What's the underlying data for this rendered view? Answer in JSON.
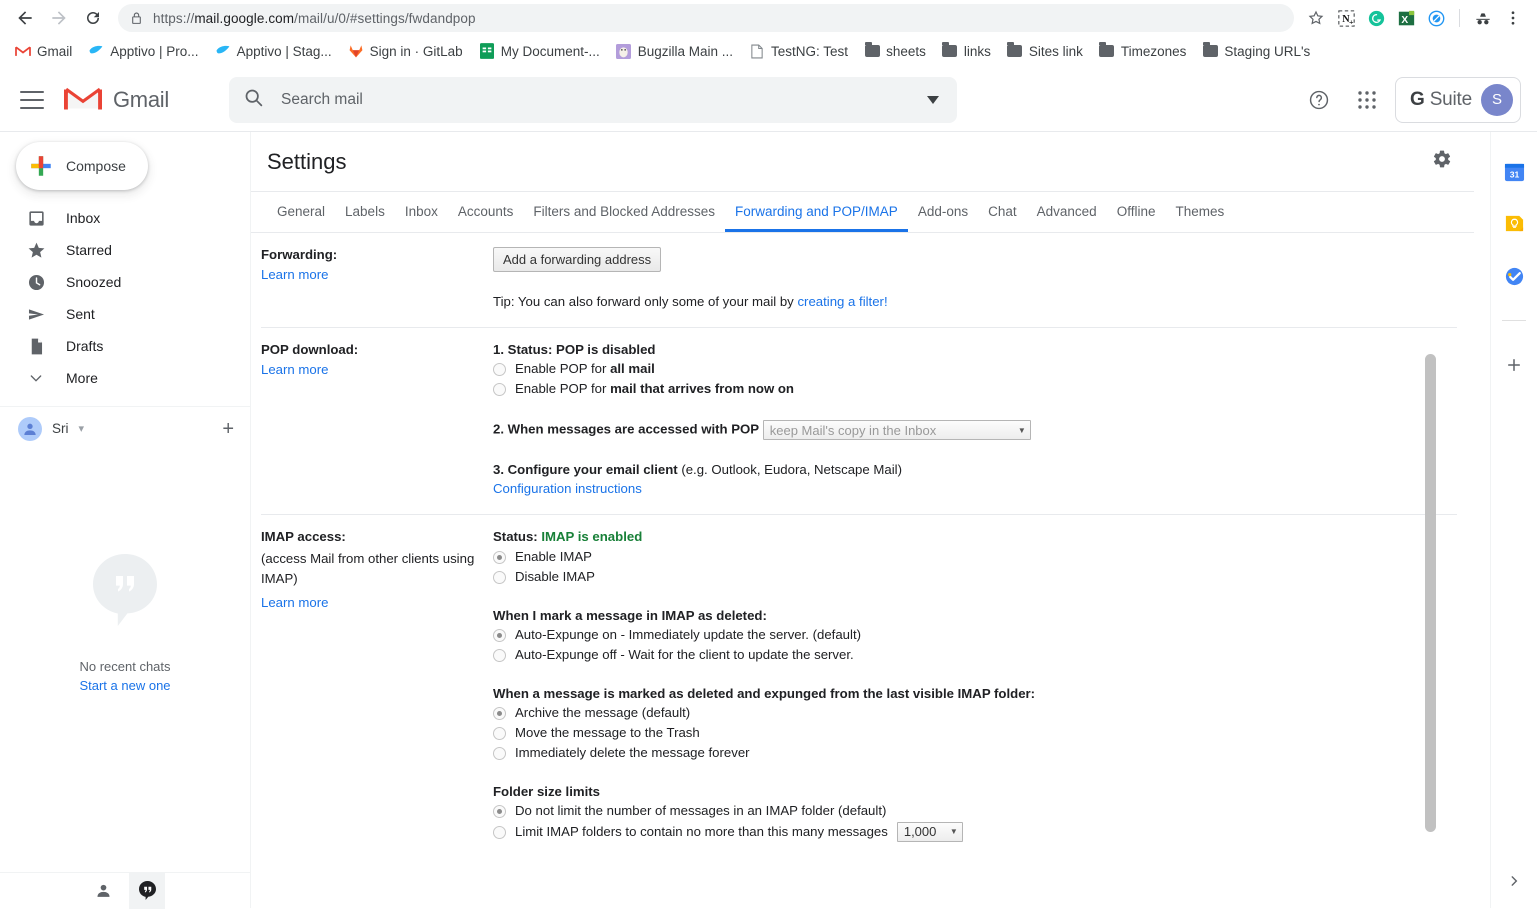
{
  "browser": {
    "url_prefix": "https://",
    "url_host": "mail.google.com",
    "url_path": "/mail/u/0/#settings/fwdandpop",
    "back_icon": "←",
    "forward_icon": "→",
    "reload_icon": "⟳",
    "lock_icon": "lock-icon",
    "star_icon": "star-icon",
    "extension_icons": [
      "notion-extension-icon",
      "grammarly-extension-icon",
      "excel-extension-icon",
      "colorzilla-extension-icon"
    ],
    "incognito_icon": "incognito-icon",
    "menu_icon": "kebab-menu-icon",
    "bookmarks": [
      {
        "label": "Gmail",
        "icon": "gmail-icon"
      },
      {
        "label": "Apptivo | Pro...",
        "icon": "apptivo-icon"
      },
      {
        "label": "Apptivo | Stag...",
        "icon": "apptivo-icon"
      },
      {
        "label": "Sign in · GitLab",
        "icon": "gitlab-icon"
      },
      {
        "label": "My Document-...",
        "icon": "sheets-icon"
      },
      {
        "label": "Bugzilla Main ...",
        "icon": "bugzilla-icon"
      },
      {
        "label": "TestNG: Test",
        "icon": "page-icon"
      },
      {
        "label": "sheets",
        "icon": "folder-icon"
      },
      {
        "label": "links",
        "icon": "folder-icon"
      },
      {
        "label": "Sites link",
        "icon": "folder-icon"
      },
      {
        "label": "Timezones",
        "icon": "folder-icon"
      },
      {
        "label": "Staging URL's",
        "icon": "folder-icon"
      }
    ]
  },
  "gmail_header": {
    "menu_icon": "hamburger-menu-icon",
    "logo_label": "Gmail",
    "search_placeholder": "Search mail",
    "search_value": "",
    "search_icon": "search-icon",
    "search_options_icon": "chevron-down-icon",
    "help_icon": "help-icon",
    "apps_icon": "google-apps-grid-icon",
    "gsuite_g": "G",
    "gsuite_label": " Suite",
    "avatar_initial": "S"
  },
  "sidebar": {
    "compose_label": "Compose",
    "compose_icon": "plus-icon",
    "items": [
      {
        "label": "Inbox",
        "icon": "inbox-icon"
      },
      {
        "label": "Starred",
        "icon": "star-icon"
      },
      {
        "label": "Snoozed",
        "icon": "clock-icon"
      },
      {
        "label": "Sent",
        "icon": "send-icon"
      },
      {
        "label": "Drafts",
        "icon": "draft-icon"
      },
      {
        "label": "More",
        "icon": "chevron-down-icon"
      }
    ],
    "hangouts_user": "Sri",
    "hangouts_user_caret": "▾",
    "hangouts_add_icon": "plus-icon",
    "chat_empty_icon": "hangouts-bubble-icon",
    "chat_empty_text": "No recent chats",
    "chat_new_link": "Start a new one",
    "footer_contacts_icon": "person-icon",
    "footer_hangouts_icon": "hangouts-icon"
  },
  "settings": {
    "title": "Settings",
    "gear_icon": "gear-icon",
    "tabs": [
      {
        "label": "General",
        "active": false
      },
      {
        "label": "Labels",
        "active": false
      },
      {
        "label": "Inbox",
        "active": false
      },
      {
        "label": "Accounts",
        "active": false
      },
      {
        "label": "Filters and Blocked Addresses",
        "active": false
      },
      {
        "label": "Forwarding and POP/IMAP",
        "active": true
      },
      {
        "label": "Add-ons",
        "active": false
      },
      {
        "label": "Chat",
        "active": false
      },
      {
        "label": "Advanced",
        "active": false
      },
      {
        "label": "Offline",
        "active": false
      },
      {
        "label": "Themes",
        "active": false
      }
    ],
    "forwarding": {
      "label": "Forwarding:",
      "learn_more": "Learn more",
      "add_button": "Add a forwarding address",
      "tip_prefix": "Tip: You can also forward only some of your mail by ",
      "tip_link": "creating a filter!"
    },
    "pop": {
      "label": "POP download:",
      "learn_more": "Learn more",
      "status_line": "1. Status: POP is disabled",
      "opt_all_prefix": "Enable POP for ",
      "opt_all_bold": "all mail",
      "opt_new_prefix": "Enable POP for ",
      "opt_new_bold": "mail that arrives from now on",
      "step2_label": "2. When messages are accessed with POP",
      "step2_select_value": "keep Mail's copy in the Inbox",
      "step3_bold": "3. Configure your email client",
      "step3_rest": " (e.g. Outlook, Eudora, Netscape Mail)",
      "config_link": "Configuration instructions"
    },
    "imap": {
      "label": "IMAP access:",
      "sub": "(access Mail from other clients using IMAP)",
      "learn_more": "Learn more",
      "status_prefix": "Status: ",
      "status_value": "IMAP is enabled",
      "status_color": "#188038",
      "enable_label": "Enable IMAP",
      "disable_label": "Disable IMAP",
      "deleted_heading": "When I mark a message in IMAP as deleted:",
      "expunge_on": "Auto-Expunge on - Immediately update the server. (default)",
      "expunge_off": "Auto-Expunge off - Wait for the client to update the server.",
      "expunged_heading": "When a message is marked as deleted and expunged from the last visible IMAP folder:",
      "expunged_archive": "Archive the message (default)",
      "expunged_trash": "Move the message to the Trash",
      "expunged_delete": "Immediately delete the message forever",
      "folder_limits_heading": "Folder size limits",
      "no_limit": "Do not limit the number of messages in an IMAP folder (default)",
      "limit_prefix": "Limit IMAP folders to contain no more than this many messages",
      "limit_value": "1,000"
    }
  },
  "right_rail": {
    "items": [
      {
        "icon": "google-calendar-icon",
        "label": "31"
      },
      {
        "icon": "google-keep-icon",
        "label": ""
      },
      {
        "icon": "google-tasks-icon",
        "label": ""
      }
    ],
    "add_icon": "plus-icon",
    "expand_icon": "chevron-right-icon"
  }
}
